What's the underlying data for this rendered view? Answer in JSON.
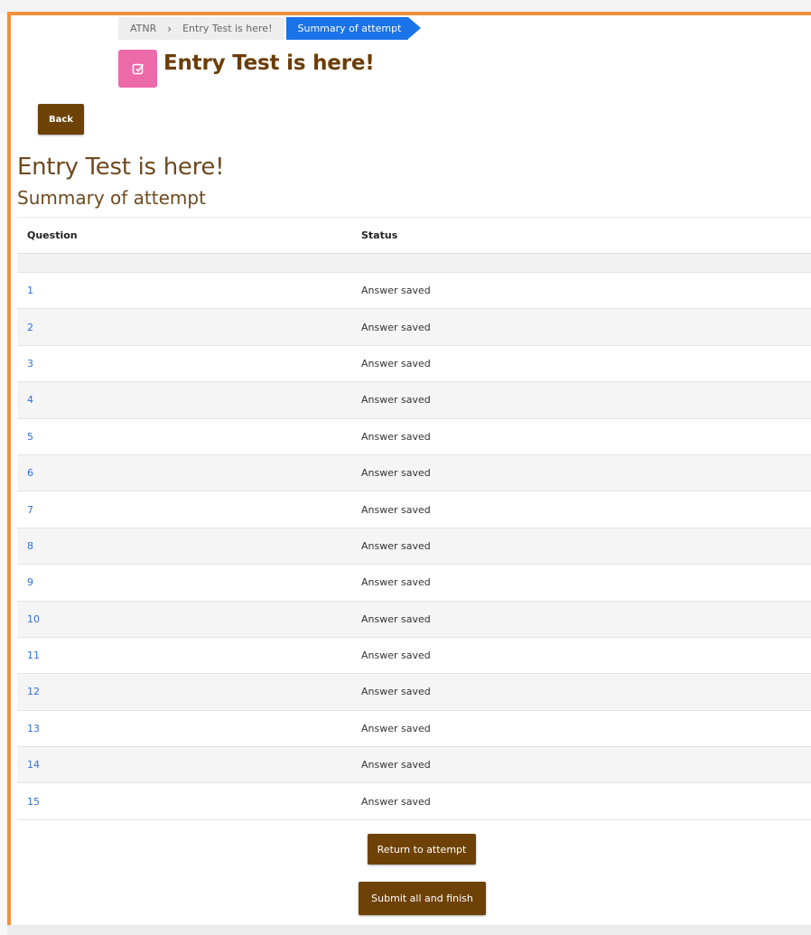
{
  "breadcrumb": {
    "items": [
      "ATNR",
      "Entry Test is here!"
    ],
    "separator": "›",
    "active": "Summary of attempt"
  },
  "header": {
    "title": "Entry Test is here!",
    "icon": "quiz-edit-icon"
  },
  "buttons": {
    "back": "Back",
    "return": "Return to attempt",
    "submit": "Submit all and finish"
  },
  "main": {
    "title": "Entry Test is here!",
    "subtitle": "Summary of attempt"
  },
  "table": {
    "headers": {
      "question": "Question",
      "status": "Status"
    },
    "rows": [
      {
        "q": "1",
        "status": "Answer saved"
      },
      {
        "q": "2",
        "status": "Answer saved"
      },
      {
        "q": "3",
        "status": "Answer saved"
      },
      {
        "q": "4",
        "status": "Answer saved"
      },
      {
        "q": "5",
        "status": "Answer saved"
      },
      {
        "q": "6",
        "status": "Answer saved"
      },
      {
        "q": "7",
        "status": "Answer saved"
      },
      {
        "q": "8",
        "status": "Answer saved"
      },
      {
        "q": "9",
        "status": "Answer saved"
      },
      {
        "q": "10",
        "status": "Answer saved"
      },
      {
        "q": "11",
        "status": "Answer saved"
      },
      {
        "q": "12",
        "status": "Answer saved"
      },
      {
        "q": "13",
        "status": "Answer saved"
      },
      {
        "q": "14",
        "status": "Answer saved"
      },
      {
        "q": "15",
        "status": "Answer saved"
      }
    ]
  },
  "colors": {
    "accent_border": "#f0913b",
    "button_brown": "#6e4207",
    "breadcrumb_active": "#1a73e8",
    "icon_pink": "#ec6aa9",
    "link_blue": "#2f6fde"
  }
}
